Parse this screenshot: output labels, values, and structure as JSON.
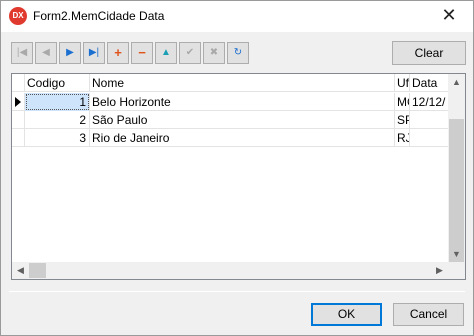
{
  "window": {
    "title": "Form2.MemCidade Data",
    "icon_text": "DX"
  },
  "navigator": {
    "buttons": [
      {
        "name": "first",
        "glyph": "|◀",
        "state": "disabled"
      },
      {
        "name": "prior",
        "glyph": "◀",
        "state": "disabled"
      },
      {
        "name": "next",
        "glyph": "▶",
        "state": "enabled"
      },
      {
        "name": "last",
        "glyph": "▶|",
        "state": "enabled"
      },
      {
        "name": "insert",
        "glyph": "+",
        "state": "enabled"
      },
      {
        "name": "delete",
        "glyph": "−",
        "state": "enabled"
      },
      {
        "name": "edit",
        "glyph": "▲",
        "state": "enabled"
      },
      {
        "name": "post",
        "glyph": "✔",
        "state": "disabled"
      },
      {
        "name": "cancel",
        "glyph": "✖",
        "state": "disabled"
      },
      {
        "name": "refresh",
        "glyph": "↻",
        "state": "enabled"
      }
    ]
  },
  "clear_label": "Clear",
  "grid": {
    "columns": [
      "Codigo",
      "Nome",
      "Uf",
      "Data"
    ],
    "rows": [
      {
        "codigo": "1",
        "nome": "Belo Horizonte",
        "uf": "MG",
        "data": "12/12/"
      },
      {
        "codigo": "2",
        "nome": "São Paulo",
        "uf": "SP",
        "data": ""
      },
      {
        "codigo": "3",
        "nome": "Rio de Janeiro",
        "uf": "RJ",
        "data": ""
      }
    ]
  },
  "buttons": {
    "ok": "OK",
    "cancel": "Cancel"
  }
}
